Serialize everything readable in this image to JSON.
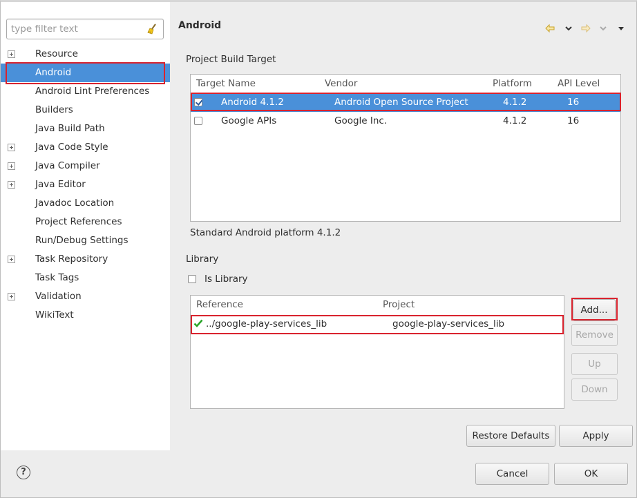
{
  "filter": {
    "placeholder": "type filter text"
  },
  "tree": [
    {
      "label": "Resource",
      "expandable": true
    },
    {
      "label": "Android",
      "expandable": false,
      "selected": true
    },
    {
      "label": "Android Lint Preferences",
      "expandable": false
    },
    {
      "label": "Builders",
      "expandable": false
    },
    {
      "label": "Java Build Path",
      "expandable": false
    },
    {
      "label": "Java Code Style",
      "expandable": true
    },
    {
      "label": "Java Compiler",
      "expandable": true
    },
    {
      "label": "Java Editor",
      "expandable": true
    },
    {
      "label": "Javadoc Location",
      "expandable": false
    },
    {
      "label": "Project References",
      "expandable": false
    },
    {
      "label": "Run/Debug Settings",
      "expandable": false
    },
    {
      "label": "Task Repository",
      "expandable": true
    },
    {
      "label": "Task Tags",
      "expandable": false
    },
    {
      "label": "Validation",
      "expandable": true
    },
    {
      "label": "WikiText",
      "expandable": false
    }
  ],
  "page": {
    "title": "Android"
  },
  "build_target": {
    "section_label": "Project Build Target",
    "columns": [
      "Target Name",
      "Vendor",
      "Platform",
      "API Level"
    ],
    "rows": [
      {
        "checked": true,
        "selected": true,
        "name": "Android 4.1.2",
        "vendor": "Android Open Source Project",
        "platform": "4.1.2",
        "api": "16"
      },
      {
        "checked": false,
        "selected": false,
        "name": "Google APIs",
        "vendor": "Google Inc.",
        "platform": "4.1.2",
        "api": "16"
      }
    ],
    "description": "Standard Android platform 4.1.2"
  },
  "library": {
    "section_label": "Library",
    "is_library_label": "Is Library",
    "is_library_checked": false,
    "columns": [
      "Reference",
      "Project"
    ],
    "rows": [
      {
        "reference": "../google-play-services_lib",
        "project": "google-play-services_lib",
        "status_icon": "check-icon"
      }
    ],
    "buttons": {
      "add": "Add...",
      "remove": "Remove",
      "up": "Up",
      "down": "Down"
    }
  },
  "footer": {
    "restore_defaults": "Restore Defaults",
    "apply": "Apply",
    "cancel": "Cancel",
    "ok": "OK"
  },
  "colors": {
    "selection": "#4a90d9",
    "highlight": "#d9232e",
    "check": "#2aa52a"
  }
}
